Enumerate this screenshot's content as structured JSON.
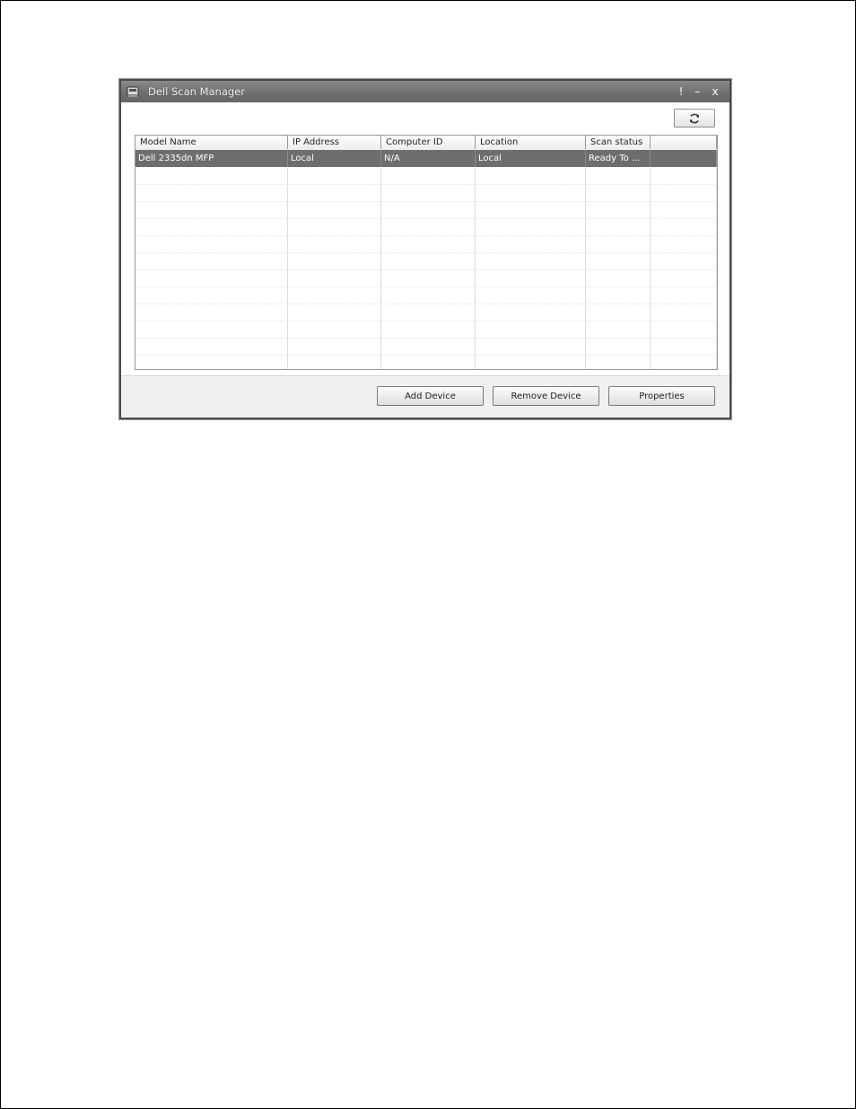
{
  "window": {
    "title": "Dell Scan Manager",
    "controls": {
      "pin": "!",
      "minimize": "–",
      "close": "x"
    }
  },
  "toolbar": {
    "refresh_icon": "refresh-icon"
  },
  "list": {
    "columns": [
      "Model Name",
      "IP Address",
      "Computer ID",
      "Location",
      "Scan status",
      ""
    ],
    "rows": [
      {
        "model_name": "Dell 2335dn MFP",
        "ip_address": "Local",
        "computer_id": "N/A",
        "location": "Local",
        "scan_status": "Ready To ...",
        "selected": true
      }
    ]
  },
  "buttons": {
    "add_device": "Add Device",
    "remove_device": "Remove Device",
    "properties": "Properties"
  }
}
